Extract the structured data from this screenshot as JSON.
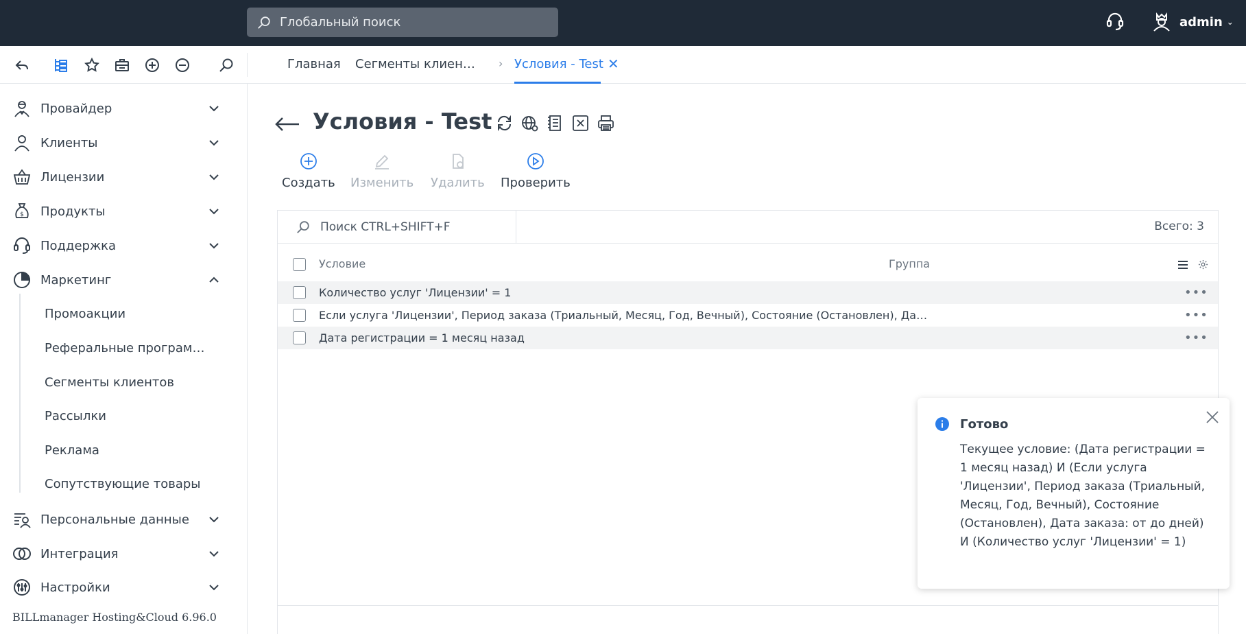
{
  "topbar": {
    "search_placeholder": "Глобальный поиск",
    "username": "admin"
  },
  "breadcrumbs": {
    "home": "Главная",
    "segments": "Сегменты клиен…",
    "current": "Условия - Test"
  },
  "sidebar": {
    "items": [
      {
        "label": "Провайдер",
        "icon": "provider-icon"
      },
      {
        "label": "Клиенты",
        "icon": "clients-icon"
      },
      {
        "label": "Лицензии",
        "icon": "basket-icon"
      },
      {
        "label": "Продукты",
        "icon": "money-bag-icon"
      },
      {
        "label": "Поддержка",
        "icon": "headset-icon"
      },
      {
        "label": "Маркетинг",
        "icon": "pie-chart-icon"
      },
      {
        "label": "Персональные данные",
        "icon": "personal-data-icon"
      },
      {
        "label": "Интеграция",
        "icon": "integration-icon"
      },
      {
        "label": "Настройки",
        "icon": "settings-sliders-icon"
      }
    ],
    "marketing_sub": [
      "Промоакции",
      "Реферальные програм…",
      "Сегменты клиентов",
      "Рассылки",
      "Реклама",
      "Сопутствующие товары"
    ],
    "version": "BILLmanager Hosting&Cloud 6.96.0"
  },
  "page": {
    "title": "Условия - Test"
  },
  "actions": {
    "create": "Создать",
    "edit": "Изменить",
    "delete": "Удалить",
    "check": "Проверить"
  },
  "table": {
    "search_placeholder": "Поиск CTRL+SHIFT+F",
    "total": "Всего: 3",
    "col_condition": "Условие",
    "col_group": "Группа",
    "rows": [
      {
        "condition": "Количество услуг 'Лицензии' = 1",
        "group": ""
      },
      {
        "condition": "Если услуга 'Лицензии', Период заказа (Триальный, Месяц, Год, Вечный), Состояние (Остановлен), Да…",
        "group": ""
      },
      {
        "condition": "Дата регистрации = 1 месяц назад",
        "group": ""
      }
    ]
  },
  "toast": {
    "title": "Готово",
    "body": "Текущее условие: (Дата регистрации = 1 месяц назад) И (Если услуга 'Лицензии', Период заказа (Триальный, Месяц, Год, Вечный), Состояние (Остановлен), Дата заказа: от до дней) И (Количество услуг 'Лицензии' = 1)"
  },
  "colors": {
    "topbar_bg": "#1f2a37",
    "accent": "#2b7de9",
    "text": "#343f4b"
  }
}
